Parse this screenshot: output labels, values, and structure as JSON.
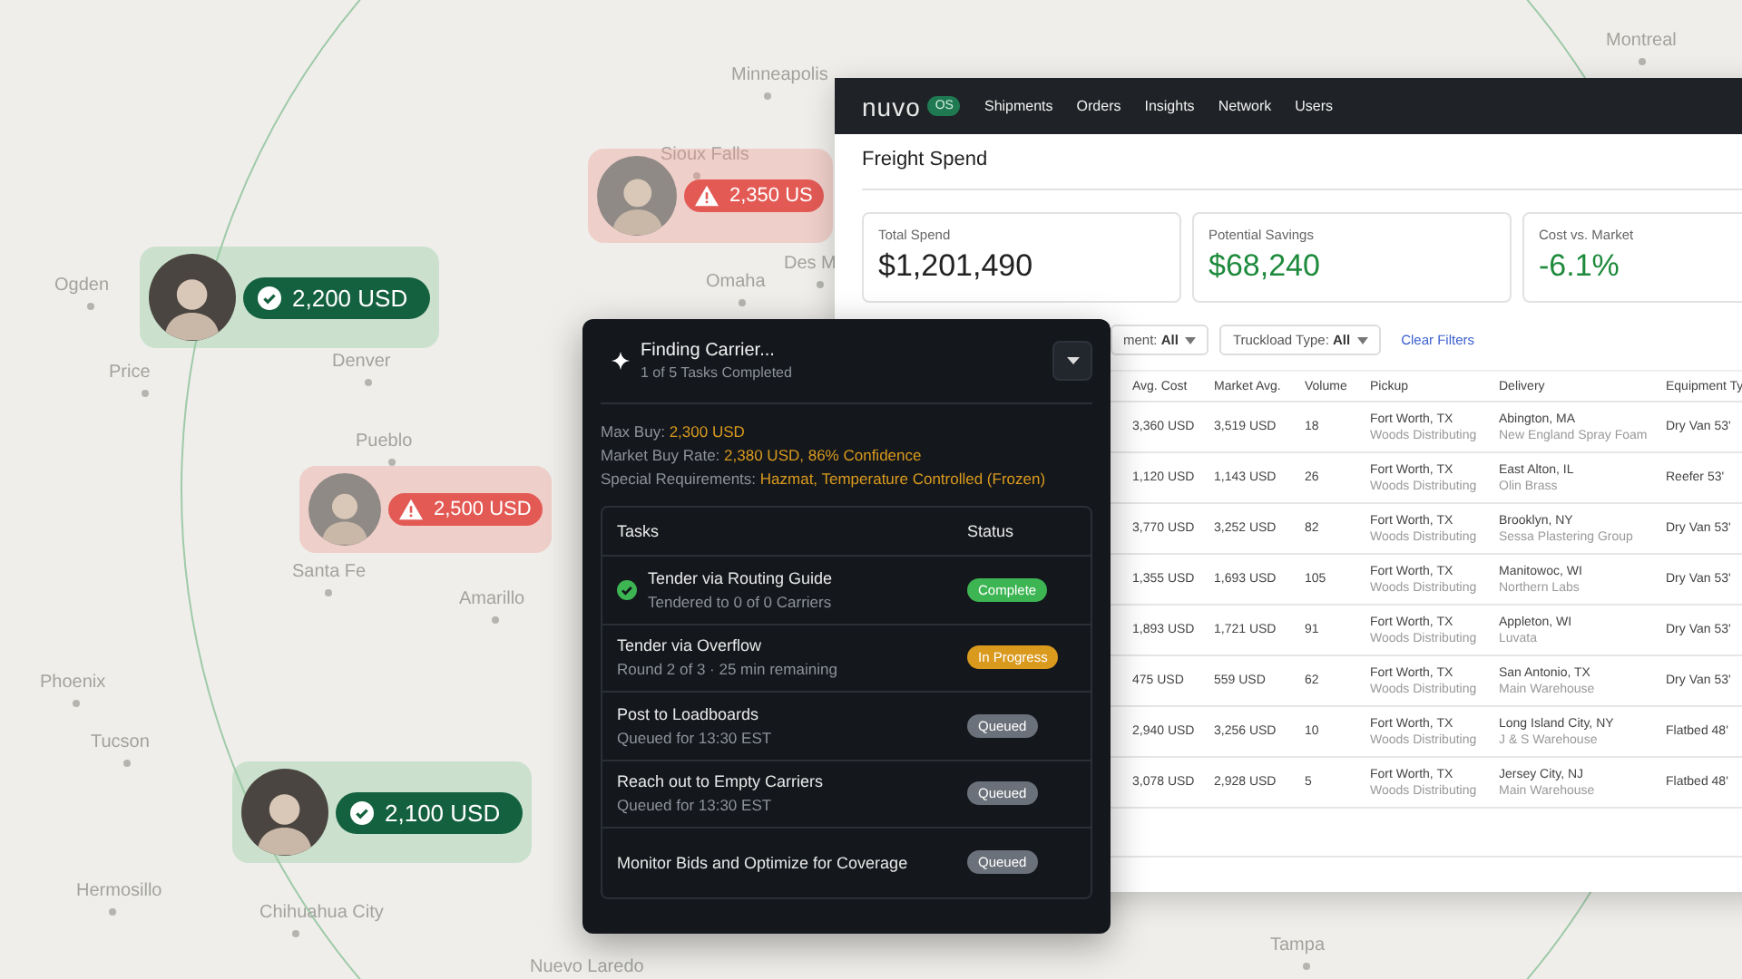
{
  "map": {
    "cities": [
      "Minneapolis",
      "Sioux Falls",
      "Ogden",
      "Price",
      "Denver",
      "Omaha",
      "Des M",
      "Pueblo",
      "Santa Fe",
      "Amarillo",
      "Phoenix",
      "Tucson",
      "Hermosillo",
      "Chihuahua City",
      "Nuevo Laredo",
      "Tampa",
      "Montreal"
    ]
  },
  "carrier_pins": [
    {
      "kind": "accepted",
      "price": "2,200 USD"
    },
    {
      "kind": "over_budget",
      "price": "2,350 US"
    },
    {
      "kind": "over_budget",
      "price": "2,500 USD"
    },
    {
      "kind": "accepted",
      "price": "2,100 USD"
    }
  ],
  "app": {
    "brand": "nuvo",
    "brand_badge": "OS",
    "nav": [
      "Shipments",
      "Orders",
      "Insights",
      "Network",
      "Users"
    ],
    "page_title": "Freight Spend",
    "metrics": [
      {
        "label": "Total Spend",
        "value": "$1,201,490",
        "color": "#222222"
      },
      {
        "label": "Potential Savings",
        "value": "$68,240",
        "color": "#1e8a3c"
      },
      {
        "label": "Cost vs. Market",
        "value": "-6.1%",
        "color": "#1e8a3c"
      }
    ],
    "filters": [
      {
        "label": "ment:",
        "value": "All"
      },
      {
        "label": "Truckload Type:",
        "value": "All"
      }
    ],
    "clear_filters": "Clear Filters",
    "table": {
      "columns": [
        "Avg. Cost",
        "Market Avg.",
        "Volume",
        "Pickup",
        "Delivery",
        "Equipment Ty"
      ],
      "rows": [
        {
          "avg_cost": "3,360 USD",
          "market_avg": "3,519 USD",
          "volume": "18",
          "pickup": "Fort Worth, TX",
          "pickup_company": "Woods Distributing",
          "delivery": "Abington, MA",
          "delivery_company": "New England Spray Foam",
          "equipment": "Dry Van 53'"
        },
        {
          "avg_cost": "1,120 USD",
          "market_avg": "1,143 USD",
          "volume": "26",
          "pickup": "Fort Worth, TX",
          "pickup_company": "Woods Distributing",
          "delivery": "East Alton, IL",
          "delivery_company": "Olin Brass",
          "equipment": "Reefer 53'"
        },
        {
          "avg_cost": "3,770 USD",
          "market_avg": "3,252 USD",
          "volume": "82",
          "pickup": "Fort Worth, TX",
          "pickup_company": "Woods Distributing",
          "delivery": "Brooklyn, NY",
          "delivery_company": "Sessa Plastering Group",
          "equipment": "Dry Van 53'"
        },
        {
          "avg_cost": "1,355 USD",
          "market_avg": "1,693 USD",
          "volume": "105",
          "pickup": "Fort Worth, TX",
          "pickup_company": "Woods Distributing",
          "delivery": "Manitowoc, WI",
          "delivery_company": "Northern Labs",
          "equipment": "Dry Van 53'"
        },
        {
          "avg_cost": "1,893 USD",
          "market_avg": "1,721 USD",
          "volume": "91",
          "pickup": "Fort Worth, TX",
          "pickup_company": "Woods Distributing",
          "delivery": "Appleton, WI",
          "delivery_company": "Luvata",
          "equipment": "Dry Van 53'"
        },
        {
          "avg_cost": "475 USD",
          "market_avg": "559 USD",
          "volume": "62",
          "pickup": "Fort Worth, TX",
          "pickup_company": "Woods Distributing",
          "delivery": "San Antonio, TX",
          "delivery_company": "Main Warehouse",
          "equipment": "Dry Van 53'"
        },
        {
          "avg_cost": "2,940 USD",
          "market_avg": "3,256 USD",
          "volume": "10",
          "pickup": "Fort Worth, TX",
          "pickup_company": "Woods Distributing",
          "delivery": "Long Island City, NY",
          "delivery_company": "J & S Warehouse",
          "equipment": "Flatbed 48'"
        },
        {
          "avg_cost": "3,078 USD",
          "market_avg": "2,928 USD",
          "volume": "5",
          "pickup": "Fort Worth, TX",
          "pickup_company": "Woods Distributing",
          "delivery": "Jersey City, NJ",
          "delivery_company": "Main Warehouse",
          "equipment": "Flatbed 48'"
        }
      ]
    }
  },
  "task_panel": {
    "title": "Finding Carrier...",
    "subtitle": "1 of 5 Tasks Completed",
    "details": [
      {
        "label": "Max Buy:",
        "value": "2,300 USD"
      },
      {
        "label": "Market Buy Rate:",
        "value": "2,380 USD, 86% Confidence"
      },
      {
        "label": "Special Requirements:",
        "value": "Hazmat, Temperature Controlled (Frozen)"
      }
    ],
    "columns": [
      "Tasks",
      "Status"
    ],
    "tasks": [
      {
        "name": "Tender via Routing Guide",
        "detail": "Tendered to 0 of 0 Carriers",
        "done": true,
        "status": "Complete",
        "kind": "complete"
      },
      {
        "name": "Tender via Overflow",
        "detail": "Round 2 of 3 · 25 min remaining",
        "done": false,
        "status": "In Progress",
        "kind": "in_progress"
      },
      {
        "name": "Post to Loadboards",
        "detail": "Queued for 13:30 EST",
        "done": false,
        "status": "Queued",
        "kind": "queued"
      },
      {
        "name": "Reach out to Empty Carriers",
        "detail": "Queued for 13:30 EST",
        "done": false,
        "status": "Queued",
        "kind": "queued"
      },
      {
        "name": "Monitor Bids and Optimize for Coverage",
        "done": false,
        "status": "Queued",
        "kind": "queued"
      }
    ]
  }
}
